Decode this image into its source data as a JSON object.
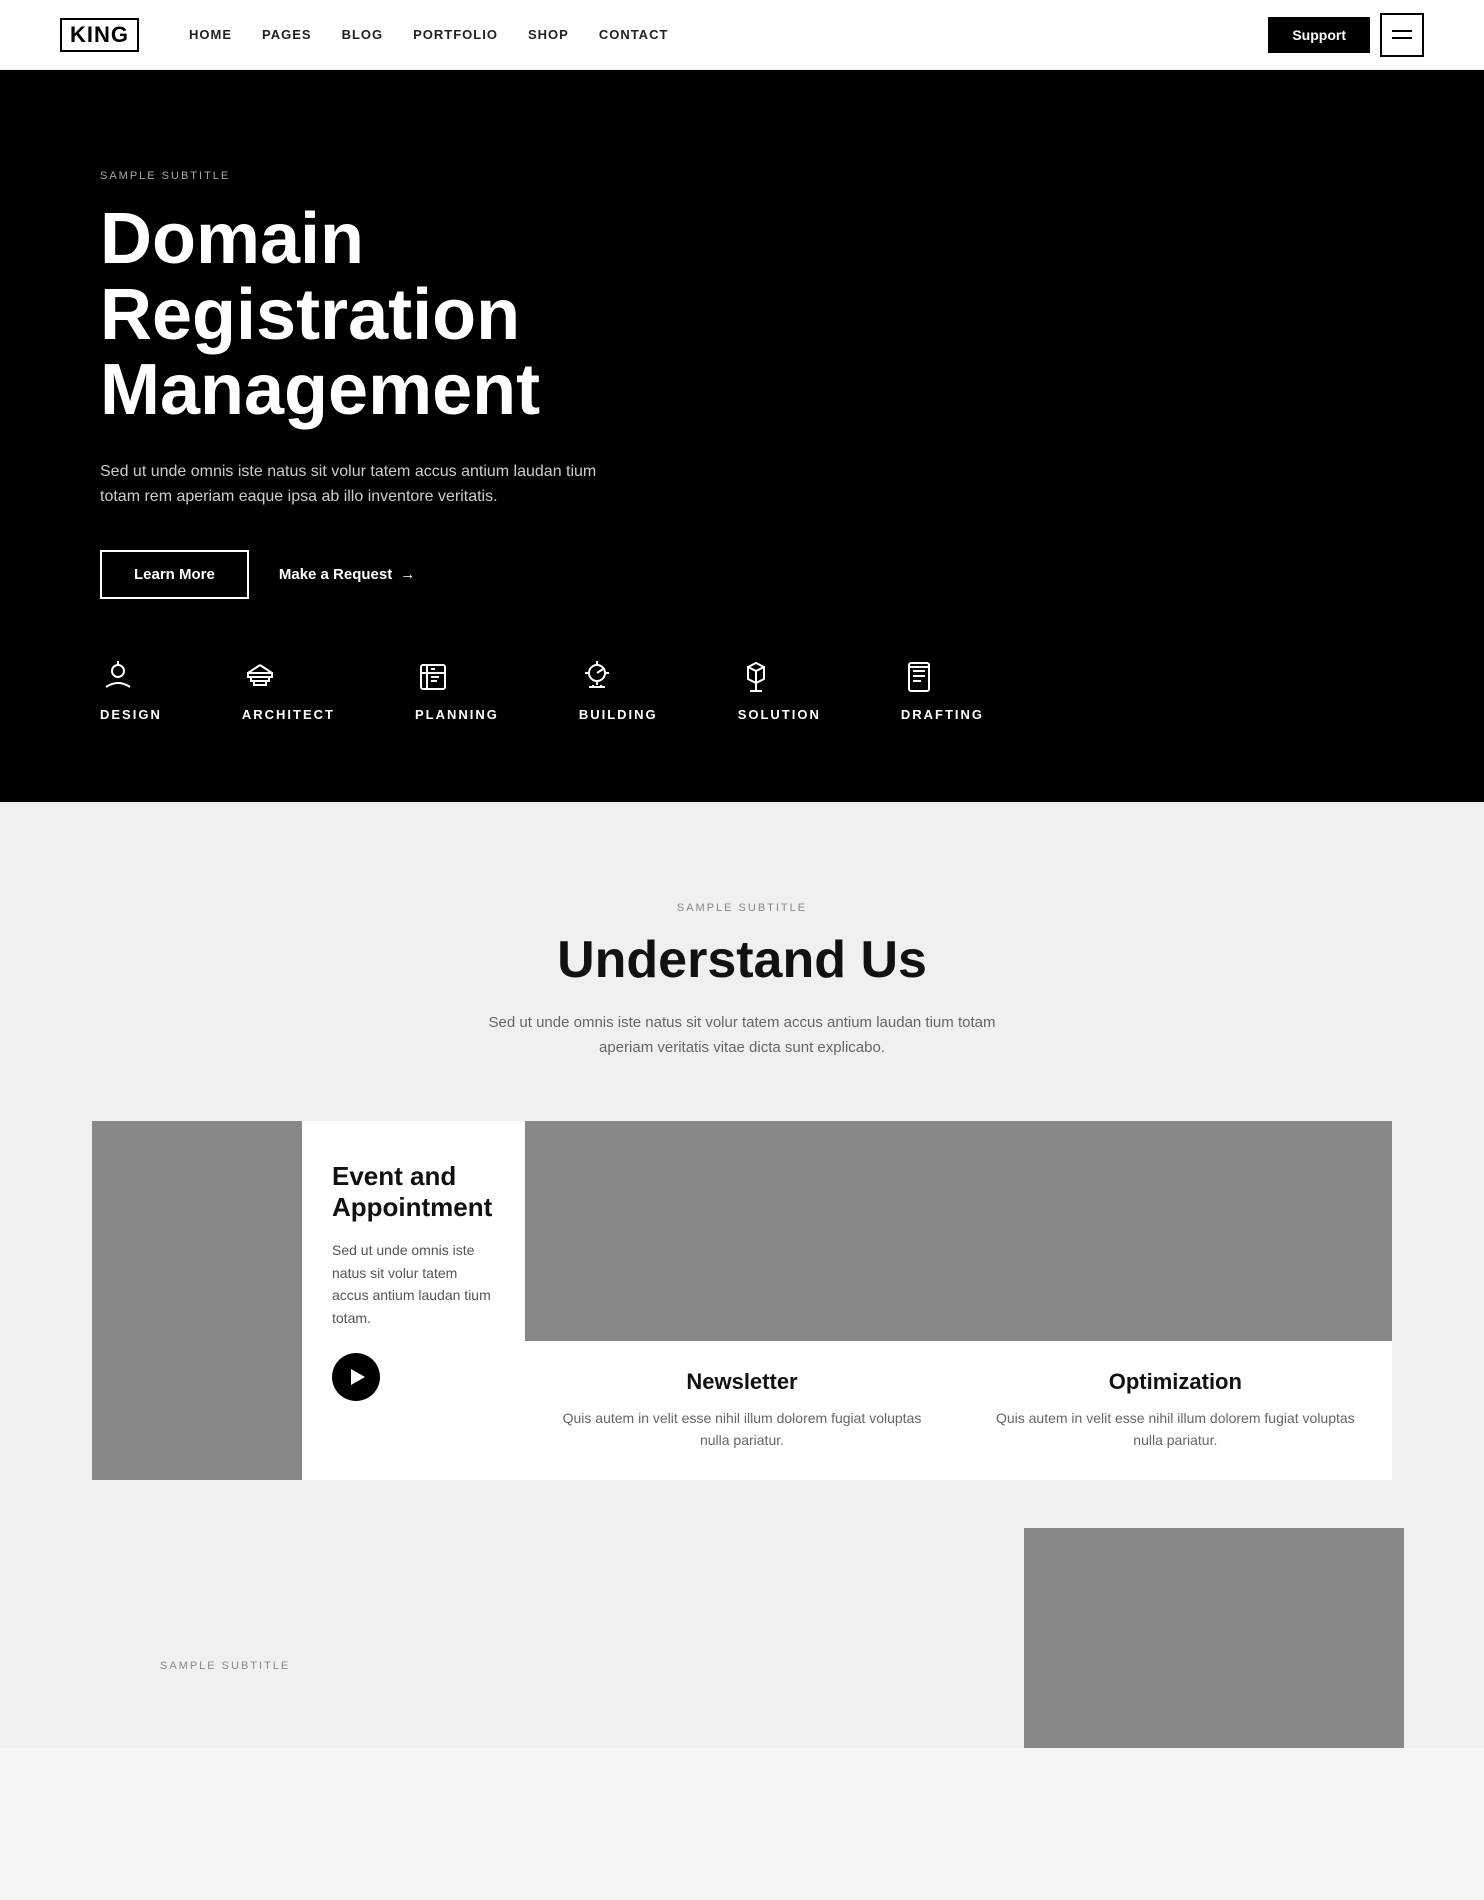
{
  "navbar": {
    "logo": "KING",
    "links": [
      {
        "label": "HOME",
        "href": "#"
      },
      {
        "label": "PAGES",
        "href": "#"
      },
      {
        "label": "BLOG",
        "href": "#"
      },
      {
        "label": "PORTFOLIO",
        "href": "#"
      },
      {
        "label": "SHOP",
        "href": "#"
      },
      {
        "label": "CONTACT",
        "href": "#"
      }
    ],
    "support_label": "Support",
    "menu_aria": "Open menu"
  },
  "hero": {
    "subtitle": "SAMPLE SUBTITLE",
    "title": "Domain Registration Management",
    "description": "Sed ut unde omnis iste natus sit volur tatem accus antium laudan tium totam rem aperiam eaque ipsa ab illo inventore veritatis.",
    "learn_more": "Learn More",
    "make_request": "Make a Request",
    "arrow": "→"
  },
  "icon_bar": [
    {
      "id": "design",
      "label": "DESIGN"
    },
    {
      "id": "architect",
      "label": "ARCHITECT"
    },
    {
      "id": "planning",
      "label": "PLANNING"
    },
    {
      "id": "building",
      "label": "BUILDING"
    },
    {
      "id": "solution",
      "label": "SOLUTION"
    },
    {
      "id": "drafting",
      "label": "DRAFTING"
    }
  ],
  "understand_section": {
    "subtitle": "SAMPLE SUBTITLE",
    "title": "Understand Us",
    "description": "Sed ut unde omnis iste natus sit volur tatem accus antium laudan tium totam aperiam veritatis vitae dicta sunt explicabo."
  },
  "cards": [
    {
      "type": "large",
      "title": "Event and Appointment",
      "description": "Sed ut unde omnis iste natus sit volur tatem accus antium laudan tium totam.",
      "has_play": true
    },
    {
      "type": "small",
      "title": "Newsletter",
      "description": "Quis autem in velit esse nihil illum dolorem fugiat voluptas nulla pariatur."
    },
    {
      "type": "small",
      "title": "Optimization",
      "description": "Quis autem in velit esse nihil illum dolorem fugiat voluptas nulla pariatur."
    }
  ],
  "bottom_section": {
    "subtitle": "SAMPLE SUBTITLE"
  }
}
